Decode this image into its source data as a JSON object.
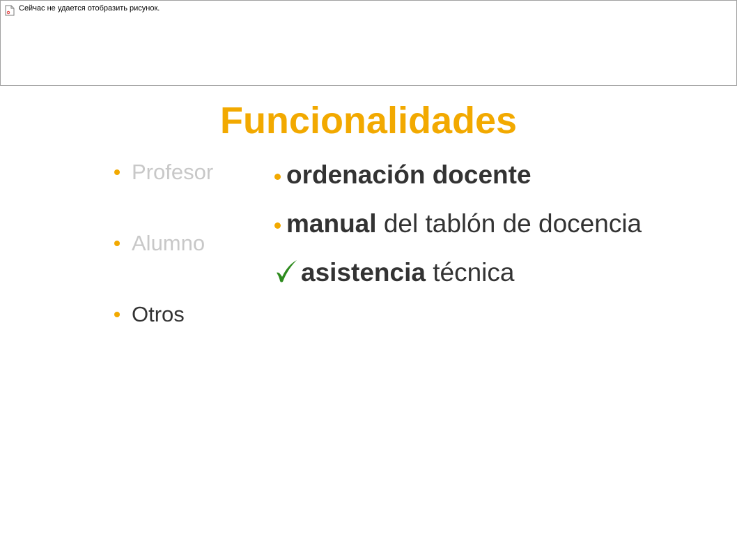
{
  "broken_image": {
    "message": "Сейчас не удается отобразить рисунок.",
    "icon": "broken-image-icon"
  },
  "title": "Funcionalidades",
  "left_list": {
    "items": [
      {
        "label": "Profesor",
        "style": "dimmed",
        "bullet": "bullet-icon"
      },
      {
        "label": "Alumno",
        "style": "dimmed",
        "bullet": "bullet-icon"
      },
      {
        "label": "Otros",
        "style": "normal",
        "bullet": "bullet-icon"
      }
    ]
  },
  "right_list": {
    "items": [
      {
        "bold": "ordenación docente",
        "rest": "",
        "marker": "bullet-icon"
      },
      {
        "bold": "manual",
        "rest": " del tablón de docencia",
        "marker": "bullet-icon"
      },
      {
        "bold": "asistencia",
        "rest": " técnica",
        "marker": "check-icon"
      }
    ]
  },
  "colors": {
    "accent": "#f2a900",
    "text": "#333333",
    "dimmed_text": "#c8c8c8",
    "check": "#2e8b1e"
  }
}
